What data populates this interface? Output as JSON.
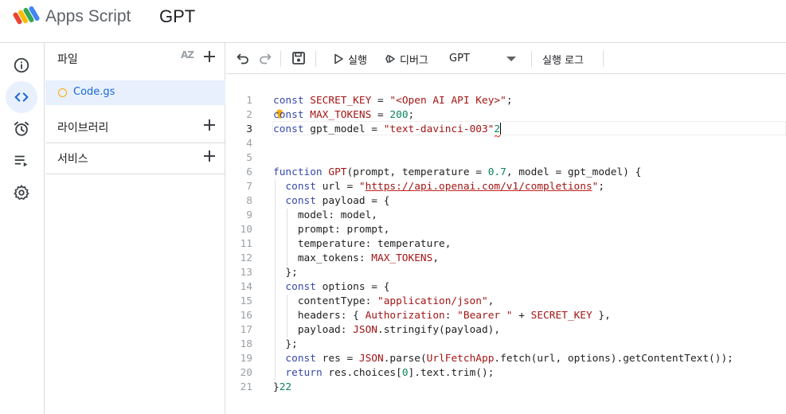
{
  "header": {
    "app_name": "Apps Script",
    "project_name": "GPT"
  },
  "rail": {
    "items": [
      "overview",
      "editor",
      "triggers",
      "executions",
      "settings"
    ],
    "active": "editor"
  },
  "files_panel": {
    "files_label": "파일",
    "sort_label": "AZ",
    "file_name": "Code.gs",
    "libraries_label": "라이브러리",
    "services_label": "서비스"
  },
  "toolbar": {
    "run_label": "실행",
    "debug_label": "디버그",
    "function_selected": "GPT",
    "log_label": "실행 로그"
  },
  "code": {
    "line_numbers": [
      "1",
      "2",
      "3",
      "4",
      "5",
      "6",
      "7",
      "8",
      "9",
      "10",
      "11",
      "12",
      "13",
      "14",
      "15",
      "16",
      "17",
      "18",
      "19",
      "20",
      "21"
    ],
    "current_line": 3,
    "lines": [
      "const SECRET_KEY = \"<Open AI API Key>\";",
      "const MAX_TOKENS = 200;",
      "const gpt_model = \"text-davinci-003\"2",
      "",
      "",
      "function GPT(prompt, temperature = 0.7, model = gpt_model) {",
      "  const url = \"https://api.openai.com/v1/completions\";",
      "  const payload = {",
      "    model: model,",
      "    prompt: prompt,",
      "    temperature: temperature,",
      "    max_tokens: MAX_TOKENS,",
      "  };",
      "  const options = {",
      "    contentType: \"application/json\",",
      "    headers: { Authorization: \"Bearer \" + SECRET_KEY },",
      "    payload: JSON.stringify(payload),",
      "  };",
      "  const res = JSON.parse(UrlFetchApp.fetch(url, options).getContentText());",
      "  return res.choices[0].text.trim();",
      "}22"
    ]
  },
  "colors": {
    "keyword": "#3649a8",
    "string": "#a31515",
    "number": "#098658",
    "accent": "#1967d2",
    "active_bg": "#e8f0fe"
  }
}
